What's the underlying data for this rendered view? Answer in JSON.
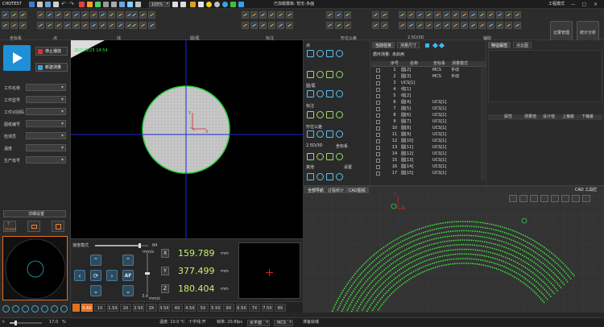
{
  "app": {
    "logo": "CHOTEST",
    "title": "已加载模板: 暂无-多面",
    "mode": "工程模式"
  },
  "toolbar": {
    "groups": [
      "坐标系",
      "点",
      "线",
      "圆/弧",
      "标注",
      "形位公差",
      "2.5D/3D",
      "辅助"
    ],
    "right_buttons": [
      "记录管理",
      "统计分析"
    ],
    "zoom_value": "100%"
  },
  "left": {
    "stop_label": "停止播放",
    "new_label": "新建测量",
    "fields": [
      "工件名称",
      "工件型号",
      "工件识别码",
      "图纸编号",
      "检测员",
      "温度",
      "生产批号"
    ],
    "details_button": "详细设置",
    "unload_label": "Unload",
    "light_value": "17.0",
    "light_unit": "%"
  },
  "view": {
    "timestamp": "2021/9/25 14:54",
    "axis_y": "Y",
    "axis_x": "X"
  },
  "dro": {
    "speed_label": "速度模式",
    "speed_value": "84",
    "speed_unit": "mm/s",
    "z_speed_value": "3.9",
    "z_speed_unit": "mm/s",
    "af_label": "AF",
    "x_value": "159.789",
    "y_value": "377.499",
    "z_value": "180.404",
    "unit": "mm",
    "axes": [
      "X",
      "Y",
      "Z"
    ]
  },
  "zoom": [
    "0.6X",
    "1X",
    "1.5X",
    "2X",
    "2.5X",
    "3X",
    "3.5X",
    "4X",
    "4.5X",
    "5X",
    "5.5X",
    "6X",
    "6.5X",
    "7X",
    "7.5X",
    "8X"
  ],
  "tools": {
    "sections": [
      "点",
      "线",
      "圆/弧",
      "标注",
      "形位公差",
      "2.5D/3D",
      "坐标系",
      "其他",
      "设置"
    ]
  },
  "table": {
    "tabs": [
      "当前任务",
      "测量尺寸"
    ],
    "filter_label": "循环测量:",
    "filter_value": "未启用",
    "headers": [
      "序号",
      "名称",
      "坐标系",
      "测量模式"
    ],
    "rows": [
      [
        "1",
        "圆[2]",
        "MCS",
        "手动"
      ],
      [
        "2",
        "圆[3]",
        "MCS",
        "手动"
      ],
      [
        "3",
        "UCS[1]",
        "",
        ""
      ],
      [
        "4",
        "线[1]",
        "",
        ""
      ],
      [
        "5",
        "线[2]",
        "",
        ""
      ],
      [
        "6",
        "圆[4]",
        "UCS[1]",
        ""
      ],
      [
        "7",
        "圆[5]",
        "UCS[1]",
        ""
      ],
      [
        "8",
        "圆[6]",
        "UCS[1]",
        ""
      ],
      [
        "9",
        "圆[7]",
        "UCS[1]",
        ""
      ],
      [
        "10",
        "圆[8]",
        "UCS[1]",
        ""
      ],
      [
        "11",
        "圆[9]",
        "UCS[1]",
        ""
      ],
      [
        "12",
        "圆[10]",
        "UCS[1]",
        ""
      ],
      [
        "13",
        "圆[11]",
        "UCS[1]",
        ""
      ],
      [
        "14",
        "圆[12]",
        "UCS[1]",
        ""
      ],
      [
        "15",
        "圆[13]",
        "UCS[1]",
        ""
      ],
      [
        "16",
        "圆[14]",
        "UCS[1]",
        ""
      ],
      [
        "17",
        "圆[15]",
        "UCS[1]",
        ""
      ]
    ]
  },
  "props": {
    "tabs": [
      "特征属性",
      "点云图"
    ],
    "headers": [
      "属性",
      "测量值",
      "设计值",
      "上偏差",
      "下偏差"
    ]
  },
  "cad": {
    "tabs": [
      "全部导航",
      "过程统计",
      "CAD图纸"
    ],
    "toolbar_label": "CAD 工具栏",
    "axis_x": "X",
    "axis_y": "Y"
  },
  "status": {
    "temp": "温度: 10.0 ℃",
    "cursor": "十字线:开",
    "fps": "帧率: 20.8fps",
    "level": "水平面",
    "cs": "MCS",
    "ready": "准备就绪"
  }
}
